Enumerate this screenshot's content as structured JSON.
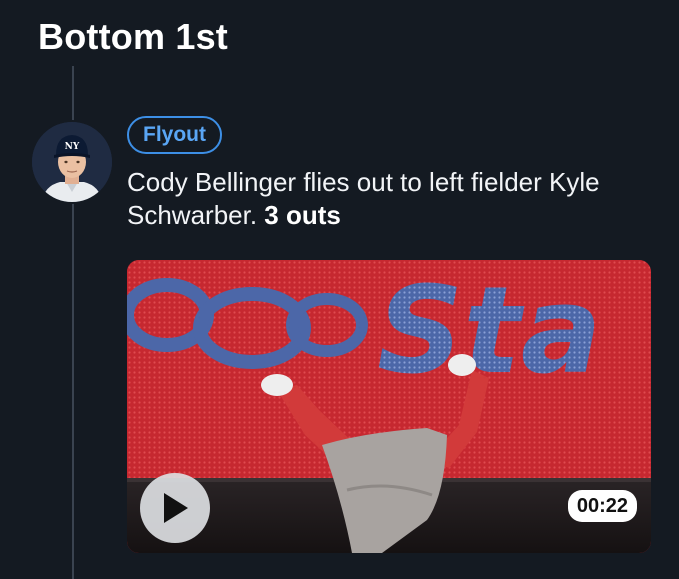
{
  "inning": {
    "title": "Bottom 1st"
  },
  "play": {
    "badge_label": "Flyout",
    "description_text": "Cody Bellinger flies out to left fielder Kyle Schwarber. ",
    "description_emphasis": "3 outs",
    "player_avatar_icon": "player-avatar-yankees",
    "team_cap_logo": "NY"
  },
  "video": {
    "duration": "00:22",
    "play_icon": "play-icon",
    "board_letters": "Sta"
  },
  "colors": {
    "background": "#141a22",
    "accent_blue": "#3d8fe6",
    "timeline": "#3a4350",
    "board_red": "#c5242c"
  }
}
